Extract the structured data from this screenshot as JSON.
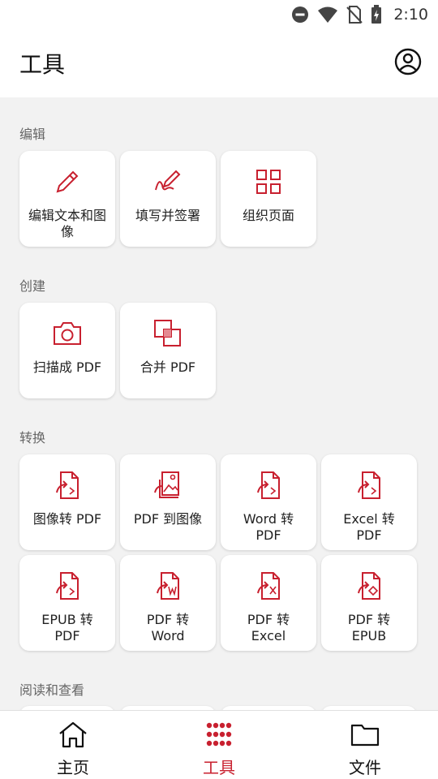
{
  "status_bar": {
    "time": "2:10"
  },
  "header": {
    "title": "工具"
  },
  "sections": [
    {
      "title": "编辑",
      "items": [
        "编辑文本和图像",
        "填写并签署",
        "组织页面"
      ]
    },
    {
      "title": "创建",
      "items": [
        "扫描成 PDF",
        "合并 PDF"
      ]
    },
    {
      "title": "转换",
      "items": [
        "图像转 PDF",
        "PDF 到图像",
        "Word 转 PDF",
        "Excel 转 PDF",
        "EPUB 转 PDF",
        "PDF 转 Word",
        "PDF 转 Excel",
        "PDF 转 EPUB"
      ]
    },
    {
      "title": "阅读和查看",
      "items": []
    }
  ],
  "bottom_nav": {
    "items": [
      {
        "label": "主页",
        "icon": "home-icon",
        "active": false
      },
      {
        "label": "工具",
        "icon": "tools-grid-icon",
        "active": true
      },
      {
        "label": "文件",
        "icon": "folder-icon",
        "active": false
      }
    ]
  },
  "colors": {
    "accent": "#c8202f",
    "background": "#f2f2f2",
    "card": "#ffffff"
  }
}
